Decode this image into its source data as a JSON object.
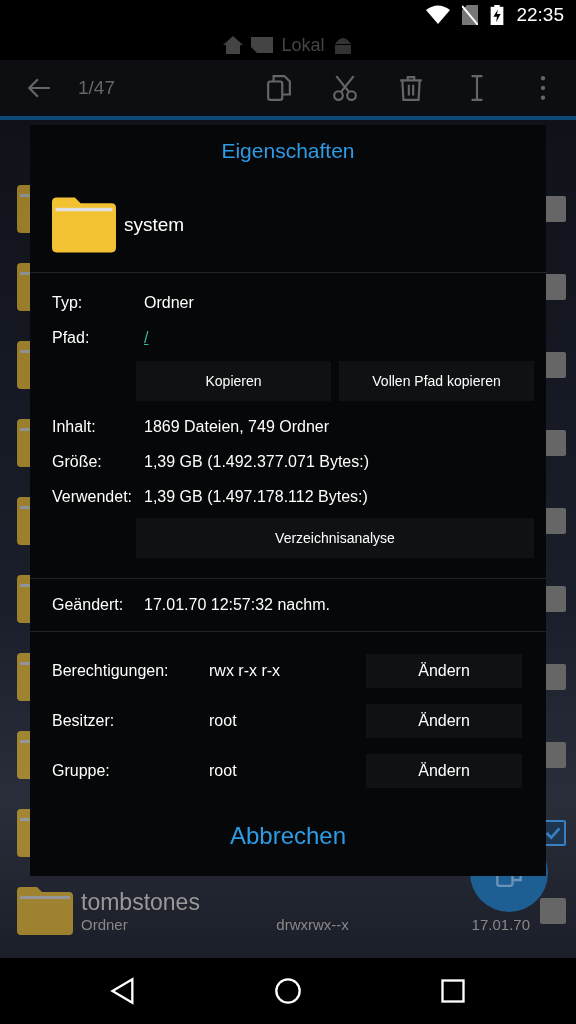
{
  "status_bar": {
    "time": "22:35"
  },
  "breadcrumb": {
    "label": "Lokal"
  },
  "toolbar": {
    "counter": "1/47"
  },
  "list": {
    "rows": [
      {
        "checked": false
      },
      {
        "checked": false
      },
      {
        "checked": false
      },
      {
        "checked": false
      },
      {
        "checked": false
      },
      {
        "checked": false
      },
      {
        "checked": false
      },
      {
        "checked": false
      },
      {
        "checked": true
      },
      {
        "checked": false,
        "name": "tombstones",
        "type": "Ordner",
        "permissions": "drwxrwx--x",
        "date": "17.01.70"
      }
    ]
  },
  "dialog": {
    "title": "Eigenschaften",
    "name": "system",
    "info": [
      {
        "label": "Typ:",
        "value": "Ordner",
        "kind": "text"
      },
      {
        "label": "Pfad:",
        "value": "/",
        "kind": "link"
      }
    ],
    "path_buttons": [
      "Kopieren",
      "Vollen Pfad kopieren"
    ],
    "stats": [
      {
        "label": "Inhalt:",
        "value": "1869 Dateien, 749 Ordner"
      },
      {
        "label": "Größe:",
        "value": "1,39 GB (1.492.377.071 Bytes:)"
      },
      {
        "label": "Verwendet:",
        "value": "1,39 GB (1.497.178.112 Bytes:)"
      }
    ],
    "analysis_button": "Verzeichnisanalyse",
    "modified": {
      "label": "Geändert:",
      "value": "17.01.70 12:57:32 nachm."
    },
    "attributes": [
      {
        "label": "Berechtigungen:",
        "value": "rwx r-x r-x",
        "button": "Ändern"
      },
      {
        "label": "Besitzer:",
        "value": "root",
        "button": "Ändern"
      },
      {
        "label": "Gruppe:",
        "value": "root",
        "button": "Ändern"
      }
    ],
    "cancel": "Abbrechen"
  }
}
